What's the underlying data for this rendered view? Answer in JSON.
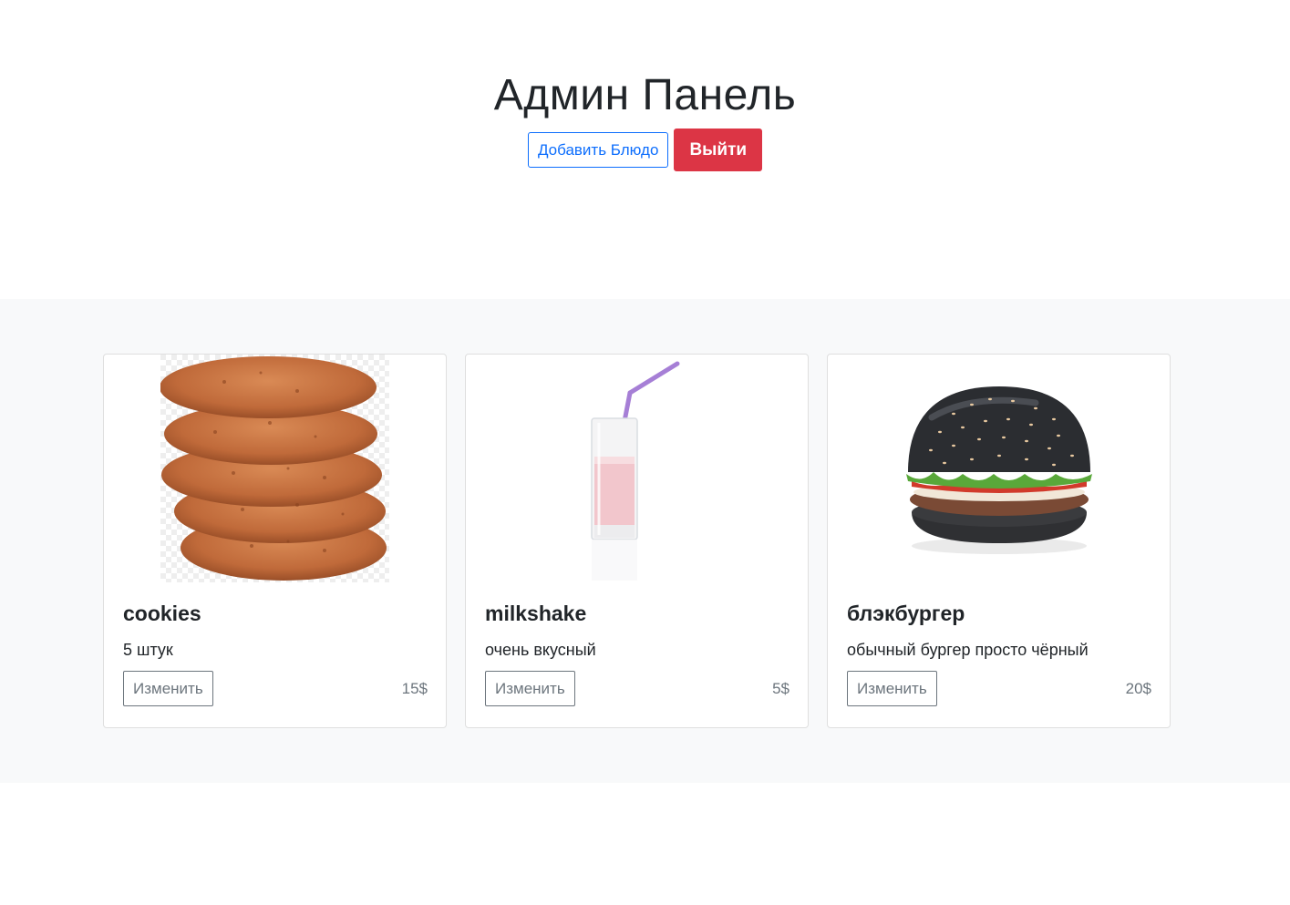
{
  "header": {
    "title": "Админ Панель",
    "add_dish_label": "Добавить Блюдо",
    "logout_label": "Выйти"
  },
  "colors": {
    "primary": "#0d6efd",
    "danger": "#dc3545",
    "secondary": "#6c757d",
    "album_bg": "#f8f9fa"
  },
  "cards": [
    {
      "image_icon": "cookies-image",
      "title": "cookies",
      "description": "5 штук",
      "edit_label": "Изменить",
      "price": "15$"
    },
    {
      "image_icon": "milkshake-image",
      "title": "milkshake",
      "description": "очень вкусный",
      "edit_label": "Изменить",
      "price": "5$"
    },
    {
      "image_icon": "burger-image",
      "title": "блэкбургер",
      "description": "обычный бургер просто чёрный",
      "edit_label": "Изменить",
      "price": "20$"
    }
  ]
}
